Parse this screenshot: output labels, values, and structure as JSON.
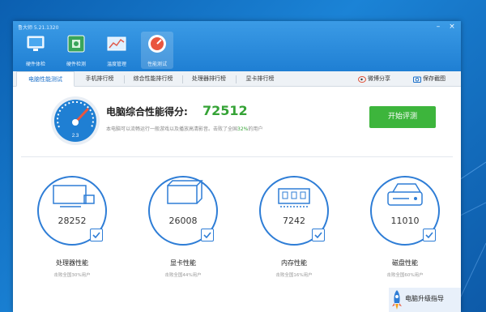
{
  "window": {
    "app_title": "鲁大师 5.21.1320",
    "controls": [
      "–",
      "×"
    ]
  },
  "nav": [
    {
      "label": "硬件体检",
      "icon": "monitor-icon"
    },
    {
      "label": "硬件检测",
      "icon": "chip-board-icon"
    },
    {
      "label": "温度管理",
      "icon": "temperature-chart-icon"
    },
    {
      "label": "性能测试",
      "icon": "speed-gauge-icon",
      "active": true
    }
  ],
  "tabs": [
    {
      "label": "电脑性能测试",
      "active": true
    },
    {
      "label": "手机排行榜"
    },
    {
      "label": "综合性能排行榜"
    },
    {
      "label": "处理器排行榜"
    },
    {
      "label": "显卡排行榜"
    }
  ],
  "share": {
    "weibo": "微博分享",
    "screenshot": "保存截图"
  },
  "score": {
    "label": "电脑综合性能得分:",
    "value": "72512",
    "desc_prefix": "本电脑可以流畅运行一般游戏以及播放高清影音。击败了全国",
    "desc_pct": "32%",
    "desc_suffix": "的用户",
    "gauge_text": "2.3"
  },
  "start_button": "开始评测",
  "cards": [
    {
      "name": "处理器性能",
      "value": "28252",
      "sub": "击败全国30%用户",
      "icon": "monitor-icon"
    },
    {
      "name": "显卡性能",
      "value": "26008",
      "sub": "击败全国44%用户",
      "icon": "gpu-cube-icon"
    },
    {
      "name": "内存性能",
      "value": "7242",
      "sub": "击败全国16%用户",
      "icon": "memory-chip-icon"
    },
    {
      "name": "磁盘性能",
      "value": "11010",
      "sub": "击败全国60%用户",
      "icon": "disk-drive-icon"
    }
  ],
  "upgrade": {
    "label": "电脑升级指导"
  },
  "colors": {
    "accent": "#1f7fd3",
    "score_green": "#35a336",
    "button_green": "#3db53c",
    "ring_blue": "#2e7dd6"
  }
}
